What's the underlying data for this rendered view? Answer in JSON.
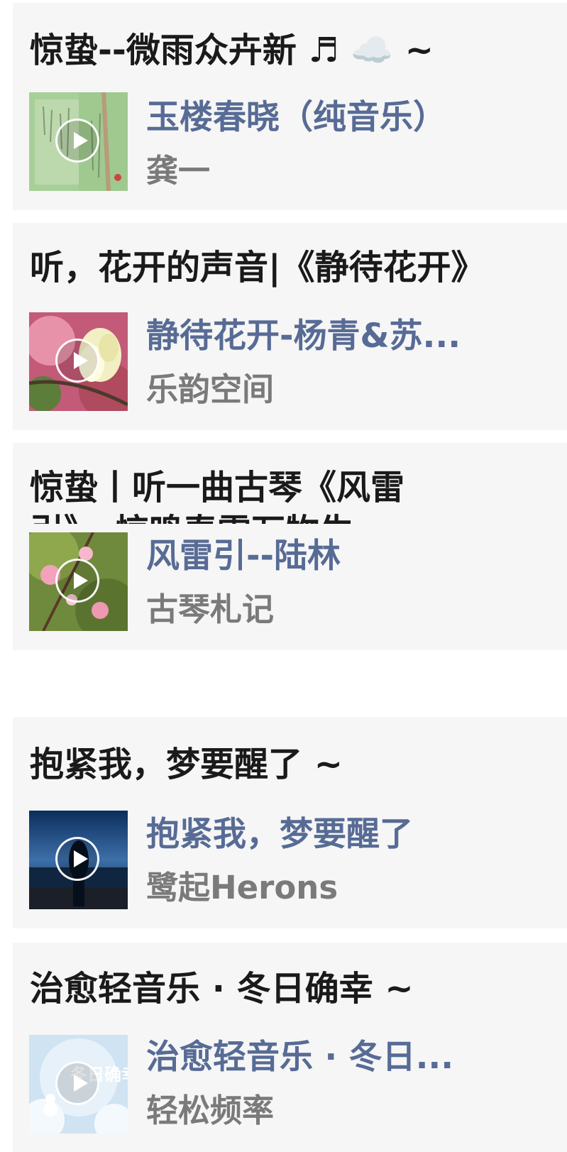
{
  "cards": [
    {
      "title": "惊蛰--微雨众卉新 ♬ ☁️ ~",
      "song": "玉楼春晓（纯音乐）",
      "artist": "龚一"
    },
    {
      "title": "听，花开的声音|《静待花开》",
      "song": "静待花开-杨青&苏...",
      "artist": "乐韵空间"
    },
    {
      "title": "惊蛰丨听一曲古琴《风雷引》，惊鸣春雷万物生",
      "song": "风雷引--陆林",
      "artist": "古琴札记"
    },
    {
      "title": "抱紧我，梦要醒了 ~",
      "song": "抱紧我，梦要醒了",
      "artist": "鹭起Herons"
    },
    {
      "title": "治愈轻音乐 · 冬日确幸 ~",
      "song": "治愈轻音乐 · 冬日...",
      "artist": "轻松频率",
      "cover_text": "冬日确幸"
    }
  ],
  "icons": {
    "play": "play-icon"
  }
}
